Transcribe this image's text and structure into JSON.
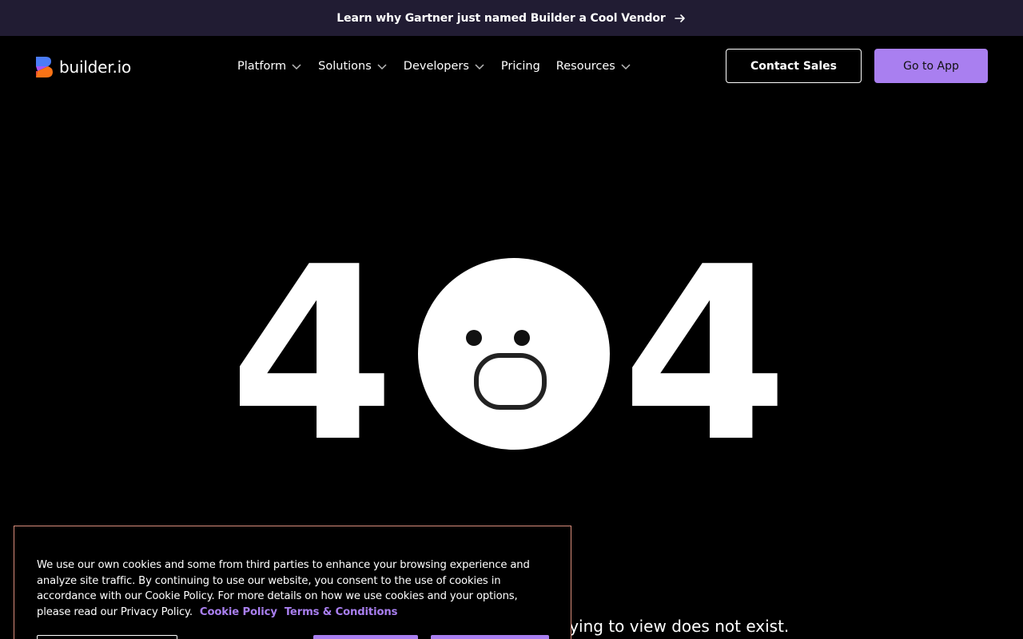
{
  "announcement": {
    "text": "Learn why Gartner just named Builder a Cool Vendor",
    "icon": "arrow-right-icon"
  },
  "brand": {
    "name": "builder.io",
    "colors": [
      "#4b7cf7",
      "#a855f7",
      "#f97316",
      "#ef4444"
    ]
  },
  "nav": {
    "items": [
      {
        "label": "Platform",
        "has_dropdown": true
      },
      {
        "label": "Solutions",
        "has_dropdown": true
      },
      {
        "label": "Developers",
        "has_dropdown": true
      },
      {
        "label": "Pricing",
        "has_dropdown": false
      },
      {
        "label": "Resources",
        "has_dropdown": true
      }
    ],
    "contact_label": "Contact Sales",
    "app_label": "Go to App"
  },
  "hero": {
    "left_digit": "4",
    "right_digit": "4",
    "face": "surprised-face-icon"
  },
  "message": {
    "visible_text": "rying to view does not exist."
  },
  "cookie": {
    "body": "We use our own cookies and some from third parties to enhance your browsing experience and analyze site traffic. By continuing to use our website, you consent to the use of cookies in accordance with our Cookie Policy. For more details on how we use cookies and your options, please read our Privacy Policy.",
    "link1": "Cookie Policy",
    "link2": "Terms & Conditions"
  },
  "colors": {
    "accent": "#a97ff0",
    "banner_bg": "#211c33",
    "page_bg": "#000000",
    "cookie_border": "#d98c7b"
  }
}
